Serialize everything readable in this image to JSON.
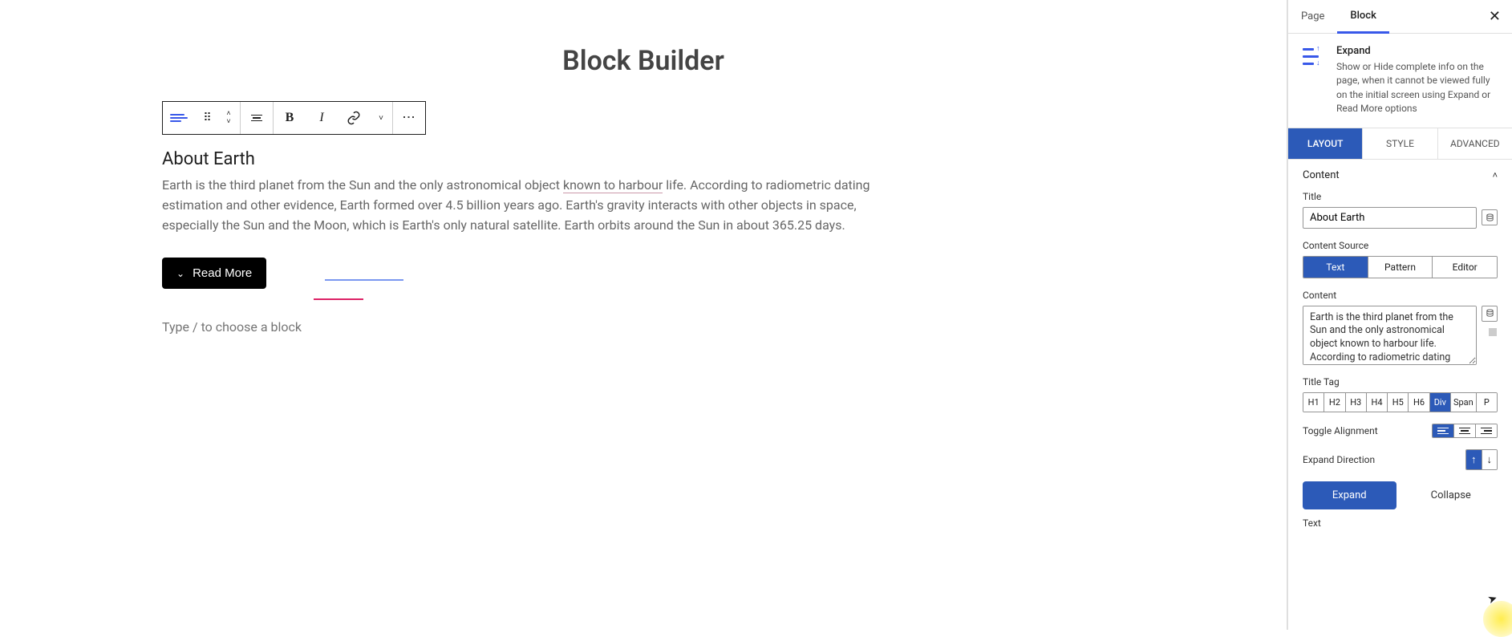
{
  "editor": {
    "page_title": "Block Builder",
    "placeholder": "Type / to choose a block",
    "block": {
      "title": "About Earth",
      "body_pre": "Earth is the third planet from the Sun and the only astronomical object ",
      "body_u": "known to harbour",
      "body_post": " life. According to radiometric dating estimation and other evidence, Earth formed over 4.5 billion years ago. Earth's gravity interacts with other objects in space, especially the Sun and the Moon, which is Earth's only natural satellite. Earth orbits around the Sun in about 365.25 days.",
      "button_label": "Read More"
    },
    "toolbar": {
      "bold": "B",
      "italic": "I"
    }
  },
  "sidebar": {
    "tabs": {
      "page": "Page",
      "block": "Block"
    },
    "block_info": {
      "name": "Expand",
      "desc": "Show or Hide complete info on the page, when it cannot be viewed fully on the initial screen using Expand or Read More options"
    },
    "mode_tabs": {
      "layout": "LAYOUT",
      "style": "STYLE",
      "advanced": "ADVANCED"
    },
    "section_content": "Content",
    "fields": {
      "title_label": "Title",
      "title_value": "About Earth",
      "content_source_label": "Content Source",
      "content_source_options": {
        "text": "Text",
        "pattern": "Pattern",
        "editor": "Editor"
      },
      "content_label": "Content",
      "content_value": "Earth is the third planet from the Sun and the only astronomical object known to harbour life. According to radiometric dating",
      "title_tag_label": "Title Tag",
      "title_tag_options": [
        "H1",
        "H2",
        "H3",
        "H4",
        "H5",
        "H6",
        "Div",
        "Span",
        "P"
      ],
      "title_tag_active": "Div",
      "toggle_alignment_label": "Toggle Alignment",
      "expand_direction_label": "Expand Direction",
      "expand_tab": "Expand",
      "collapse_tab": "Collapse",
      "text_label": "Text"
    }
  }
}
